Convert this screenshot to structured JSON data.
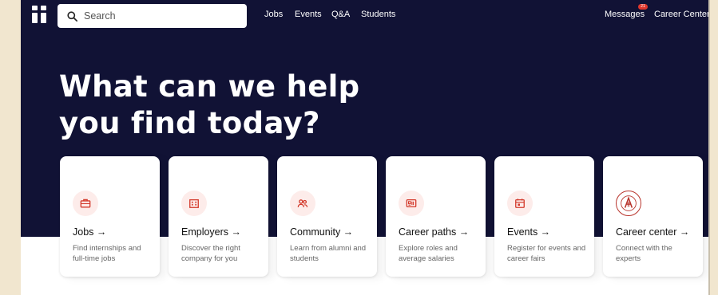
{
  "search": {
    "placeholder": "Search"
  },
  "nav": {
    "links": [
      "Jobs",
      "Events",
      "Q&A",
      "Students"
    ],
    "messages": "Messages",
    "messages_badge": "21",
    "career_center": "Career Center"
  },
  "hero": {
    "line1": "What can we help",
    "line2": "you find today?"
  },
  "cards": [
    {
      "title": "Jobs →",
      "desc": "Find internships and full-time jobs",
      "icon": "briefcase-icon"
    },
    {
      "title": "Employers →",
      "desc": "Discover the right company for you",
      "icon": "building-icon"
    },
    {
      "title": "Community →",
      "desc": "Learn from alumni and students",
      "icon": "people-icon"
    },
    {
      "title": "Career paths →",
      "desc": "Explore roles and average salaries",
      "icon": "roles-icon"
    },
    {
      "title": "Events →",
      "desc": "Register for events and career fairs",
      "icon": "calendar-icon"
    },
    {
      "title": "Career center →",
      "desc": "Connect with the experts",
      "icon": "school-seal-icon"
    }
  ],
  "colors": {
    "hero_bg": "#111235",
    "accent": "#d33a2c",
    "icon_bg": "#fdecea"
  }
}
